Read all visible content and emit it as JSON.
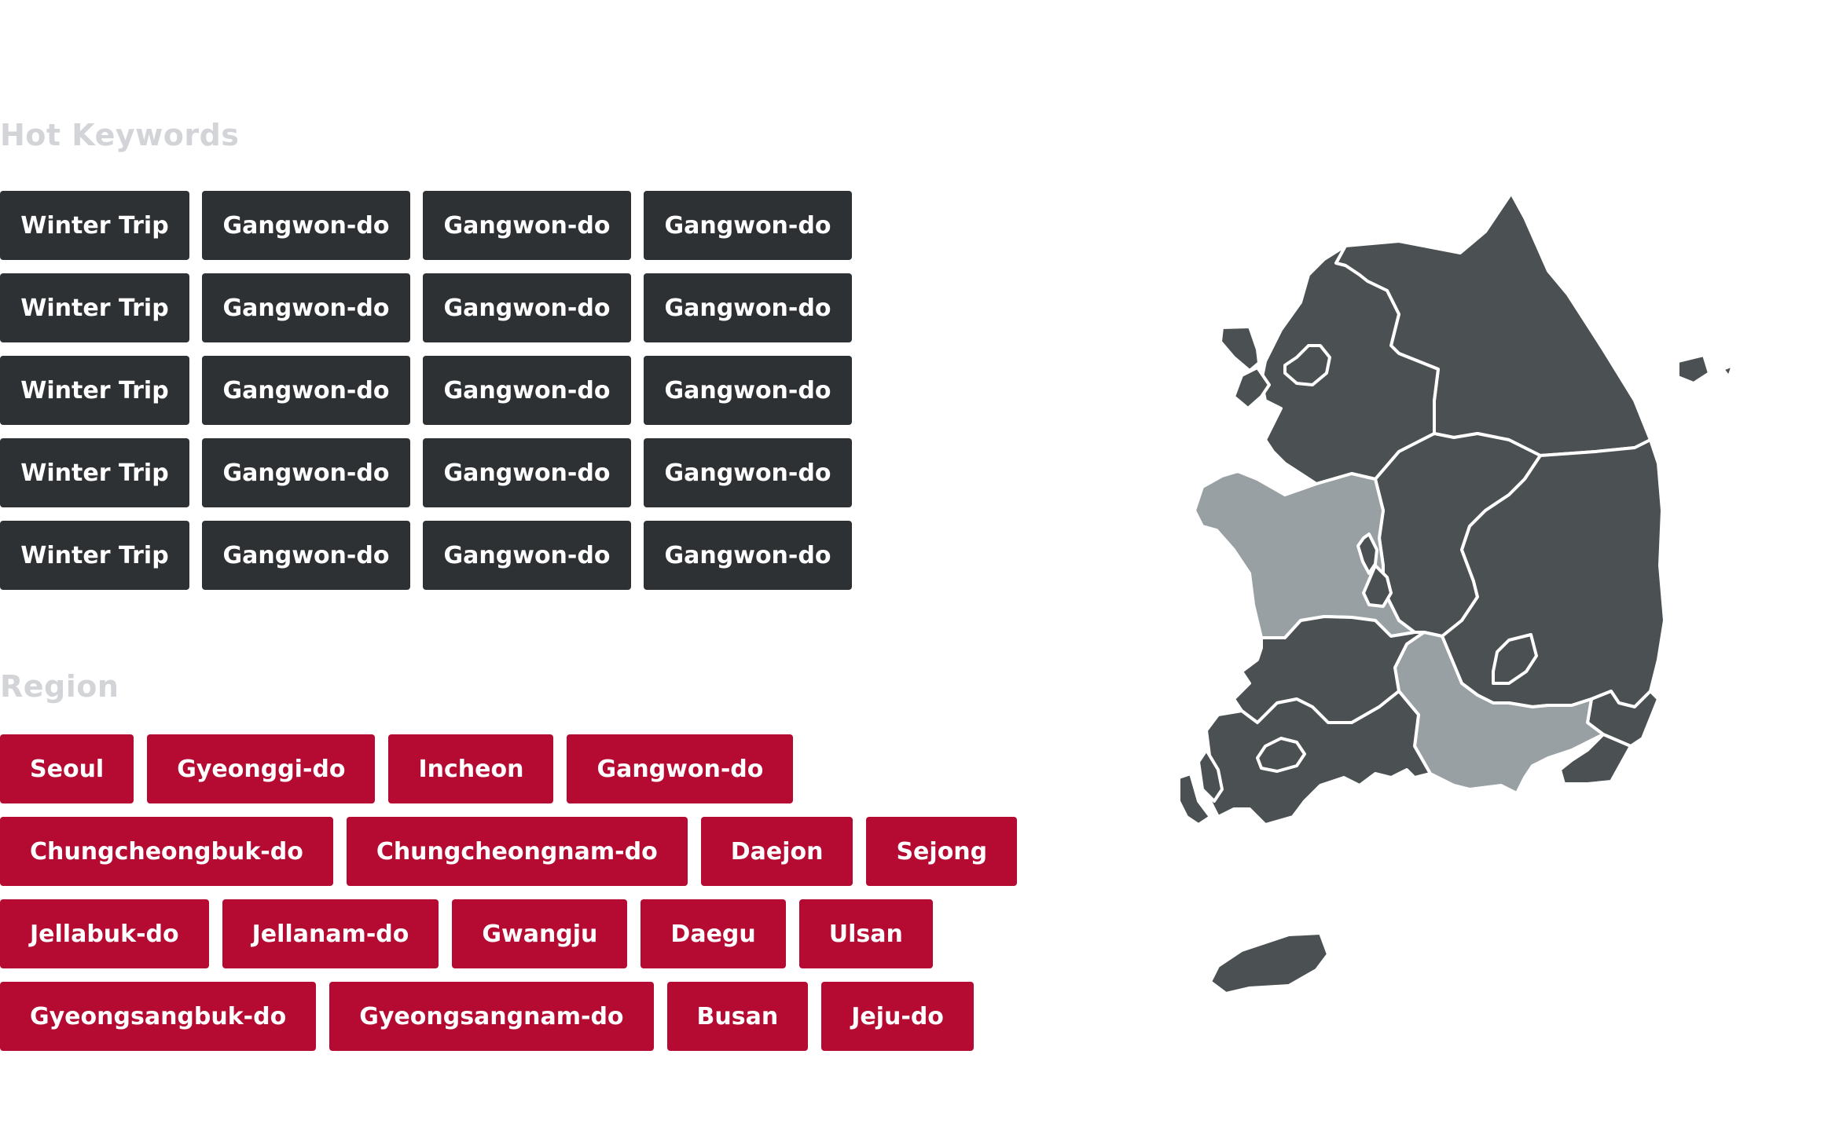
{
  "hot_keywords": {
    "title": "Hot Keywords",
    "rows": [
      [
        "Winter Trip",
        "Gangwon-do",
        "Gangwon-do",
        "Gangwon-do"
      ],
      [
        "Winter Trip",
        "Gangwon-do",
        "Gangwon-do",
        "Gangwon-do"
      ],
      [
        "Winter Trip",
        "Gangwon-do",
        "Gangwon-do",
        "Gangwon-do"
      ],
      [
        "Winter Trip",
        "Gangwon-do",
        "Gangwon-do",
        "Gangwon-do"
      ],
      [
        "Winter Trip",
        "Gangwon-do",
        "Gangwon-do",
        "Gangwon-do"
      ]
    ]
  },
  "region": {
    "title": "Region",
    "rows": [
      [
        "Seoul",
        "Gyeonggi-do",
        "Incheon",
        "Gangwon-do"
      ],
      [
        "Chungcheongbuk-do",
        "Chungcheongnam-do",
        "Daejon",
        "Sejong"
      ],
      [
        "Jellabuk-do",
        "Jellanam-do",
        "Gwangju",
        "Daegu",
        "Ulsan"
      ],
      [
        "Gyeongsangbuk-do",
        "Gyeongsangnam-do",
        "Busan",
        "Jeju-do"
      ]
    ]
  },
  "map": {
    "highlighted_regions": [
      "Chungcheongnam-do",
      "Gyeongsangnam-do"
    ]
  },
  "colors": {
    "section_title": "#d2d4d7",
    "keyword_button_bg": "#2e3133",
    "region_button_bg": "#b50b33",
    "button_text": "#ffffff",
    "map_region": "#4b5052",
    "map_region_highlight": "#98a0a4",
    "map_border": "#ffffff"
  }
}
